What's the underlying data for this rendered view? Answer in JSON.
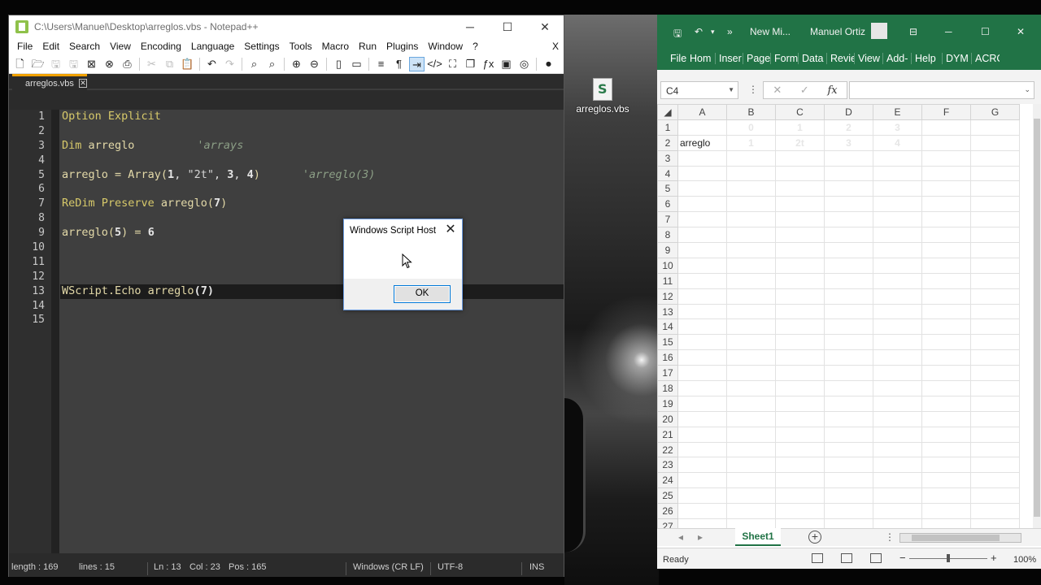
{
  "notepad": {
    "title": "C:\\Users\\Manuel\\Desktop\\arreglos.vbs - Notepad++",
    "menu": [
      "File",
      "Edit",
      "Search",
      "View",
      "Encoding",
      "Language",
      "Settings",
      "Tools",
      "Macro",
      "Run",
      "Plugins",
      "Window",
      "?"
    ],
    "menu_close": "X",
    "tab": "arreglos.vbs",
    "line_numbers": [
      "1",
      "2",
      "3",
      "4",
      "5",
      "6",
      "7",
      "8",
      "9",
      "10",
      "11",
      "12",
      "13",
      "14",
      "15"
    ],
    "code": {
      "l1_kw": "Option Explicit",
      "l3_kw": "Dim",
      "l3_id": " arreglo",
      "l3_cm": "'arrays",
      "l5_a": "arreglo = Array(",
      "l5_n1": "1",
      "l5_c1": ", ",
      "l5_s": "\"2t\"",
      "l5_c2": ", ",
      "l5_n3": "3",
      "l5_c3": ", ",
      "l5_n4": "4",
      "l5_close": ")",
      "l5_cm": "'arreglo(3)",
      "l7_kw": "ReDim Preserve",
      "l7_id": " arreglo(",
      "l7_n": "7",
      "l7_close": ")",
      "l9_a": "arreglo(",
      "l9_n1": "5",
      "l9_b": ") = ",
      "l9_n2": "6",
      "l13_a": "WScript.Echo arreglo",
      "l13_open": "(",
      "l13_n": "7",
      "l13_close": ")"
    },
    "status": {
      "length": "length : 169",
      "lines": "lines : 15",
      "ln": "Ln : 13",
      "col": "Col : 23",
      "pos": "Pos : 165",
      "eol": "Windows (CR LF)",
      "encoding": "UTF-8",
      "mode": "INS"
    }
  },
  "dialog": {
    "title": "Windows Script Host",
    "ok": "OK"
  },
  "desktop_icon": {
    "label": "arreglos.vbs"
  },
  "excel": {
    "title": "New Mi...",
    "user": "Manuel Ortiz",
    "ribbon_tabs": [
      "File",
      "Hom",
      "Inser",
      "Page",
      "Form",
      "Data",
      "Revie",
      "View",
      "Add-",
      "Help",
      "DYM",
      "ACRO"
    ],
    "name_box": "C4",
    "columns": [
      "A",
      "B",
      "C",
      "D",
      "E",
      "F",
      "G"
    ],
    "rows": [
      [
        "",
        "0",
        "1",
        "2",
        "3",
        "",
        ""
      ],
      [
        "arreglo",
        "1",
        "2t",
        "3",
        "4",
        "",
        ""
      ]
    ],
    "row_count": 27,
    "sheet_tab": "Sheet1",
    "status": "Ready",
    "zoom": "100%"
  },
  "colors": {
    "excel_green": "#217346",
    "npp_tab_accent": "#f0a000",
    "editor_bg": "#3f3f3f"
  }
}
